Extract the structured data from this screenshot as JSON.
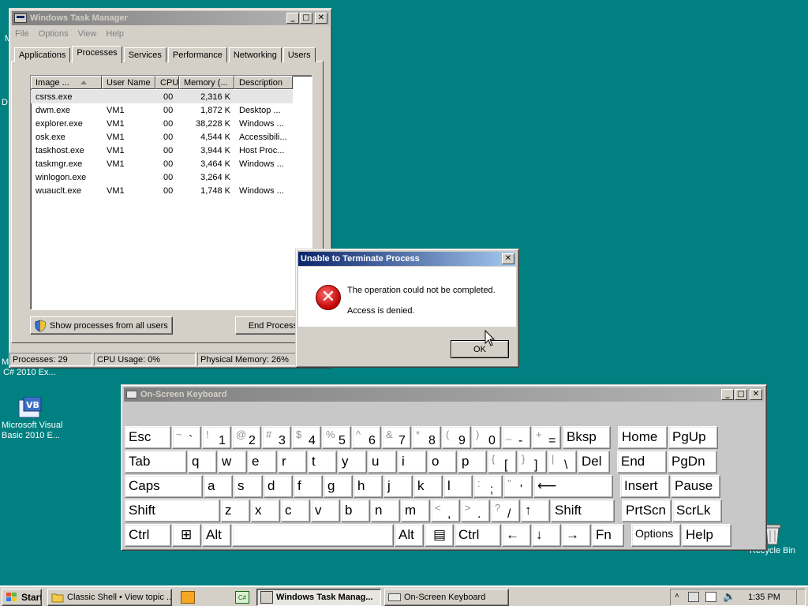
{
  "desktop": {
    "icons": [
      {
        "label_line1": "Microsoft Visual",
        "label_line2": "Basic 2010 E..."
      },
      {
        "label_line1": "Recycle Bin",
        "label_line2": ""
      }
    ],
    "partial_label": "C# 2010 Ex...",
    "edge_fragments": [
      "M",
      "D",
      "M"
    ]
  },
  "task_manager": {
    "title": "Windows Task Manager",
    "menu": [
      "File",
      "Options",
      "View",
      "Help"
    ],
    "tabs": [
      "Applications",
      "Processes",
      "Services",
      "Performance",
      "Networking",
      "Users"
    ],
    "selected_tab": "Processes",
    "columns": [
      "Image ...",
      "User Name",
      "CPU",
      "Memory (...",
      "Description"
    ],
    "rows": [
      {
        "image": "csrss.exe",
        "user": "",
        "cpu": "00",
        "memory": "2,316 K",
        "description": ""
      },
      {
        "image": "dwm.exe",
        "user": "VM1",
        "cpu": "00",
        "memory": "1,872 K",
        "description": "Desktop ..."
      },
      {
        "image": "explorer.exe",
        "user": "VM1",
        "cpu": "00",
        "memory": "38,228 K",
        "description": "Windows ..."
      },
      {
        "image": "osk.exe",
        "user": "VM1",
        "cpu": "00",
        "memory": "4,544 K",
        "description": "Accessibili..."
      },
      {
        "image": "taskhost.exe",
        "user": "VM1",
        "cpu": "00",
        "memory": "3,944 K",
        "description": "Host Proc..."
      },
      {
        "image": "taskmgr.exe",
        "user": "VM1",
        "cpu": "00",
        "memory": "3,464 K",
        "description": "Windows ..."
      },
      {
        "image": "winlogon.exe",
        "user": "",
        "cpu": "00",
        "memory": "3,264 K",
        "description": ""
      },
      {
        "image": "wuauclt.exe",
        "user": "VM1",
        "cpu": "00",
        "memory": "1,748 K",
        "description": "Windows ..."
      }
    ],
    "show_all_button": "Show processes from all users",
    "end_process_button": "End Process",
    "status": {
      "processes": "Processes: 29",
      "cpu": "CPU Usage: 0%",
      "memory": "Physical Memory: 26%"
    }
  },
  "dialog": {
    "title": "Unable to Terminate Process",
    "message1": "The operation could not be completed.",
    "message2": "Access is denied.",
    "ok_button": "OK"
  },
  "osk": {
    "title": "On-Screen Keyboard",
    "rows": [
      [
        {
          "main": "Esc",
          "w": 60
        },
        {
          "shift": "~",
          "lower": "`",
          "w": 38
        },
        {
          "shift": "!",
          "lower": "1",
          "w": 38
        },
        {
          "shift": "@",
          "lower": "2",
          "w": 38
        },
        {
          "shift": "#",
          "lower": "3",
          "w": 38
        },
        {
          "shift": "$",
          "lower": "4",
          "w": 38
        },
        {
          "shift": "%",
          "lower": "5",
          "w": 38
        },
        {
          "shift": "^",
          "lower": "6",
          "w": 38
        },
        {
          "shift": "&",
          "lower": "7",
          "w": 38
        },
        {
          "shift": "*",
          "lower": "8",
          "w": 38
        },
        {
          "shift": "(",
          "lower": "9",
          "w": 38
        },
        {
          "shift": ")",
          "lower": "0",
          "w": 38
        },
        {
          "shift": "_",
          "lower": "-",
          "w": 38
        },
        {
          "shift": "+",
          "lower": "=",
          "w": 38
        },
        {
          "main": "Bksp",
          "w": 62,
          "gap": 1
        },
        {
          "main": "Home",
          "w": 64,
          "gap": 8
        },
        {
          "main": "PgUp",
          "w": 64
        }
      ],
      [
        {
          "main": "Tab",
          "w": 80
        },
        {
          "main": "q",
          "w": 38
        },
        {
          "main": "w",
          "w": 38
        },
        {
          "main": "e",
          "w": 38
        },
        {
          "main": "r",
          "w": 38
        },
        {
          "main": "t",
          "w": 38
        },
        {
          "main": "y",
          "w": 38
        },
        {
          "main": "u",
          "w": 38
        },
        {
          "main": "i",
          "w": 38
        },
        {
          "main": "o",
          "w": 38
        },
        {
          "main": "p",
          "w": 38
        },
        {
          "shift": "{",
          "lower": "[",
          "w": 38
        },
        {
          "shift": "}",
          "lower": "]",
          "w": 38
        },
        {
          "shift": "|",
          "lower": "\\",
          "w": 38
        },
        {
          "main": "Del",
          "w": 42
        },
        {
          "main": "End",
          "w": 64,
          "gap": 8
        },
        {
          "main": "PgDn",
          "w": 64
        }
      ],
      [
        {
          "main": "Caps",
          "w": 100
        },
        {
          "main": "a",
          "w": 38
        },
        {
          "main": "s",
          "w": 38
        },
        {
          "main": "d",
          "w": 38
        },
        {
          "main": "f",
          "w": 38
        },
        {
          "main": "g",
          "w": 38
        },
        {
          "main": "h",
          "w": 38
        },
        {
          "main": "j",
          "w": 38
        },
        {
          "main": "k",
          "w": 38
        },
        {
          "main": "l",
          "w": 38
        },
        {
          "shift": ":",
          "lower": ";",
          "w": 38
        },
        {
          "shift": "\"",
          "lower": "'",
          "w": 38
        },
        {
          "main": "⟵",
          "w": 102,
          "arrow": true
        },
        {
          "main": "Insert",
          "w": 64,
          "gap": 8
        },
        {
          "main": "Pause",
          "w": 64
        }
      ],
      [
        {
          "main": "Shift",
          "w": 122
        },
        {
          "main": "z",
          "w": 38
        },
        {
          "main": "x",
          "w": 38
        },
        {
          "main": "c",
          "w": 38
        },
        {
          "main": "v",
          "w": 38
        },
        {
          "main": "b",
          "w": 38
        },
        {
          "main": "n",
          "w": 38
        },
        {
          "main": "m",
          "w": 38
        },
        {
          "shift": "<",
          "lower": ",",
          "w": 38
        },
        {
          "shift": ">",
          "lower": ".",
          "w": 38
        },
        {
          "shift": "?",
          "lower": "/",
          "w": 38
        },
        {
          "main": "↑",
          "w": 38,
          "arrow": true
        },
        {
          "main": "Shift",
          "w": 82
        },
        {
          "main": "PrtScn",
          "w": 64,
          "gap": 8
        },
        {
          "main": "ScrLk",
          "w": 64
        }
      ],
      [
        {
          "main": "Ctrl",
          "w": 60
        },
        {
          "main": "⊞",
          "w": 38,
          "icon": "windows-logo"
        },
        {
          "main": "Alt",
          "w": 38
        },
        {
          "main": "",
          "w": 206
        },
        {
          "main": "Alt",
          "w": 38
        },
        {
          "main": "▤",
          "w": 38,
          "icon": "menu"
        },
        {
          "main": "Ctrl",
          "w": 60
        },
        {
          "main": "←",
          "w": 38,
          "arrow": true
        },
        {
          "main": "↓",
          "w": 38,
          "arrow": true
        },
        {
          "main": "→",
          "w": 38,
          "arrow": true
        },
        {
          "main": "Fn",
          "w": 42
        },
        {
          "main": "Options",
          "w": 64,
          "gap": 8,
          "small": true
        },
        {
          "main": "Help",
          "w": 64
        }
      ]
    ]
  },
  "taskbar": {
    "start": "Start",
    "buttons": [
      {
        "label": "Classic Shell • View topic ...",
        "pressed": false
      },
      {
        "label": "Windows Task Manag...",
        "pressed": true
      },
      {
        "label": "On-Screen Keyboard",
        "pressed": false
      }
    ],
    "clock": "1:35 PM"
  }
}
